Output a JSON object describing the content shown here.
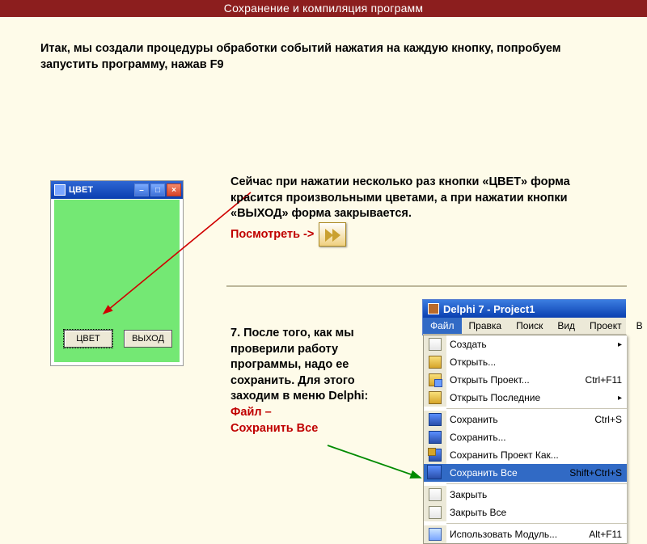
{
  "slide": {
    "title": "Сохранение и компиляция программ"
  },
  "intro": "Итак, мы создали процедуры обработки событий нажатия на каждую кнопку, попробуем запустить программу, нажав F9",
  "form": {
    "title": "ЦВЕТ",
    "btn_color": "ЦВЕТ",
    "btn_exit": "ВЫХОД"
  },
  "desc1": {
    "text": "Сейчас при нажатии несколько раз кнопки «ЦВЕТ» форма красится произвольными цветами, а при нажатии кнопки «ВЫХОД» форма закрывается.",
    "look_label": "Посмотреть ->"
  },
  "desc2": {
    "text": "7. После того, как мы проверили работу программы, надо ее сохранить. Для этого заходим в меню Delphi:",
    "em_line1": "Файл –",
    "em_line2": "Сохранить Все"
  },
  "delphi": {
    "title": "Delphi 7 - Project1",
    "menubar": [
      "Файл",
      "Правка",
      "Поиск",
      "Вид",
      "Проект",
      "В"
    ],
    "menu": [
      {
        "label": "Создать",
        "shortcut": "",
        "submenu": true,
        "icon": "ic-new"
      },
      {
        "label": "Открыть...",
        "shortcut": "",
        "icon": "ic-open"
      },
      {
        "label": "Открыть Проект...",
        "shortcut": "Ctrl+F11",
        "icon": "ic-openproj"
      },
      {
        "label": "Открыть Последние",
        "shortcut": "",
        "submenu": true,
        "icon": "ic-recent"
      },
      {
        "sep": true
      },
      {
        "label": "Сохранить",
        "shortcut": "Ctrl+S",
        "icon": "ic-save"
      },
      {
        "label": "Сохранить...",
        "shortcut": "",
        "icon": "ic-saveas"
      },
      {
        "label": "Сохранить Проект Как...",
        "shortcut": "",
        "icon": "ic-saveproj"
      },
      {
        "label": "Сохранить Все",
        "shortcut": "Shift+Ctrl+S",
        "icon": "ic-saveall",
        "hl": true
      },
      {
        "sep": true
      },
      {
        "label": "Закрыть",
        "shortcut": "",
        "icon": "ic-close"
      },
      {
        "label": "Закрыть Все",
        "shortcut": "",
        "icon": "ic-closeall"
      },
      {
        "sep": true
      },
      {
        "label": "Использовать Модуль...",
        "shortcut": "Alt+F11",
        "icon": "ic-usemod"
      }
    ]
  }
}
